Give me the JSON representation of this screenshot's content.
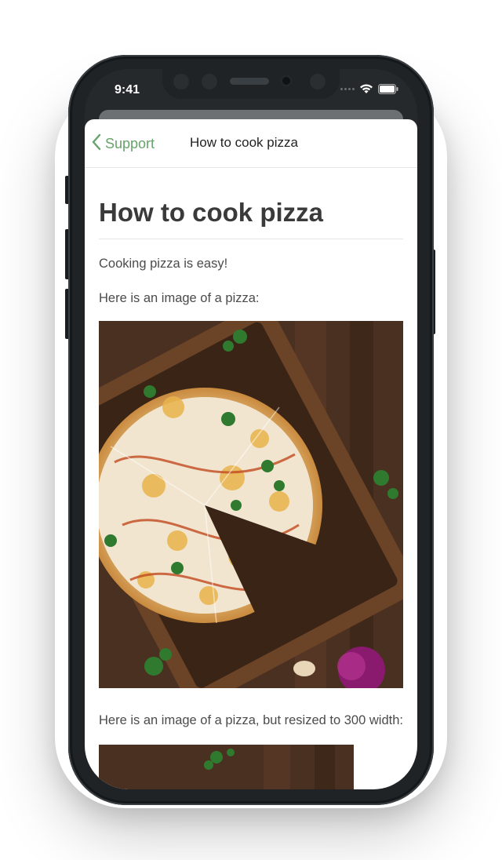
{
  "status": {
    "time": "9:41"
  },
  "navbar": {
    "back_label": "Support",
    "title": "How to cook pizza"
  },
  "article": {
    "title": "How to cook pizza",
    "paragraphs": [
      "Cooking pizza is easy!",
      "Here is an image of a pizza:",
      "Here is an image of a pizza, but resized to 300 width:"
    ]
  },
  "colors": {
    "accent": "#67a36a",
    "text": "#4b4b4b",
    "title": "#3a3a3a"
  }
}
